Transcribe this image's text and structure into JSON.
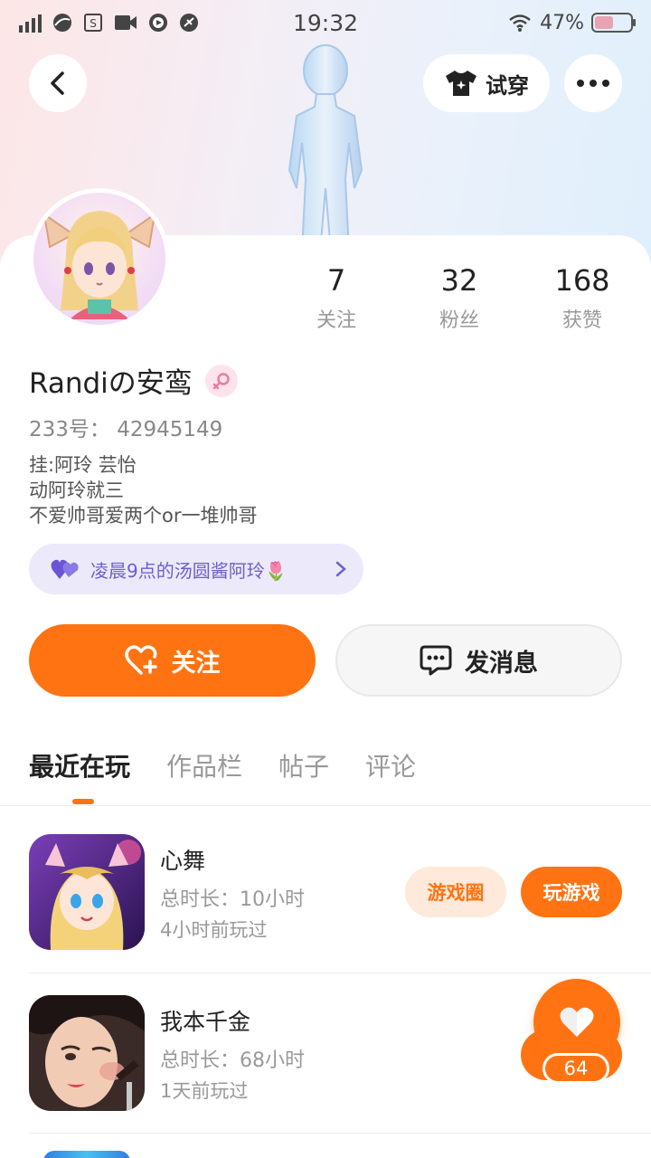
{
  "status_bar": {
    "time": "19:32",
    "battery": "47%",
    "icons": [
      "signal-icon",
      "browser-icon",
      "sim-icon",
      "video-icon",
      "play-icon",
      "game-icon",
      "wifi-icon",
      "battery-icon"
    ]
  },
  "header": {
    "try_on_label": "试穿",
    "icons": [
      "back-icon",
      "shirt-icon",
      "more-icon"
    ]
  },
  "profile": {
    "stats": [
      {
        "value": "7",
        "label": "关注"
      },
      {
        "value": "32",
        "label": "粉丝"
      },
      {
        "value": "168",
        "label": "获赞"
      }
    ],
    "name": "Randiの安鸾",
    "gender": "female",
    "uid": "233号：  42945149",
    "bio": [
      "挂:阿玲 芸怡",
      "动阿玲就三",
      "不爱帅哥爱两个or一堆帅哥"
    ],
    "guard_label": "凌晨9点的汤圆酱阿玲🌷"
  },
  "actions": {
    "follow_label": "关注",
    "message_label": "发消息"
  },
  "tabs": [
    {
      "label": "最近在玩",
      "active": true
    },
    {
      "label": "作品栏",
      "active": false
    },
    {
      "label": "帖子",
      "active": false
    },
    {
      "label": "评论",
      "active": false
    }
  ],
  "games": [
    {
      "title": "心舞",
      "duration": "总时长：10小时",
      "last_played": "4小时前玩过",
      "circle_label": "游戏圈",
      "play_label": "玩游戏"
    },
    {
      "title": "我本千金",
      "duration": "总时长：68小时",
      "last_played": "1天前玩过"
    }
  ],
  "floating_like": {
    "count": "64"
  },
  "colors": {
    "accent": "#ff7312",
    "accent_light": "#ffe9db",
    "guard_bg": "#ece9fb",
    "guard_text": "#6d5fd0"
  }
}
